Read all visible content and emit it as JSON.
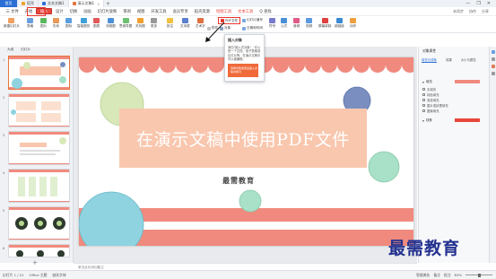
{
  "tabbar": {
    "home": "首页",
    "tabs": [
      {
        "label": "稻壳",
        "color": "#f0a030"
      },
      {
        "label": "文本文稿1",
        "color": "#2b6fd6"
      },
      {
        "label": "演示文稿1",
        "color": "#e8743a"
      }
    ],
    "add": "+",
    "window_controls": [
      "—",
      "❐",
      "✕"
    ]
  },
  "menu": {
    "items": [
      "三 文件",
      "开始",
      "插入",
      "设计",
      "切换",
      "动画",
      "幻灯片放映",
      "审阅",
      "视图",
      "开发工具",
      "会员专享",
      "稻壳资源",
      "绘图工具",
      "文本工具",
      "Q 查找"
    ],
    "selected": "插入",
    "right": [
      "未同步",
      "协作",
      "分享"
    ]
  },
  "ribbon": {
    "buttons": [
      "新建幻灯片",
      "表格",
      "图片",
      "形状",
      "图标",
      "智能图形",
      "图表",
      "流程图",
      "思维导图",
      "关系图",
      "更多",
      "批注",
      "文本框",
      "艺术字",
      "符号",
      "公式",
      "音频",
      "视频",
      "屏幕录制",
      "超链接",
      "动作"
    ],
    "small": [
      "PDF文件",
      "对象",
      "附件",
      "幻灯片编号",
      "日期和时间",
      "页眉页脚"
    ],
    "pdf_label": "PDF文件"
  },
  "tooltip": {
    "title": "插入对象",
    "body": "添加\"嵌入式对象\"，可以是一个文档、电子表格或幻灯片等，在演示文稿中可以被编辑。",
    "image_text": "选择对象类型后插入文稿中即可"
  },
  "left_pane": {
    "tabs": [
      "大纲",
      "幻灯片"
    ],
    "slide_numbers": [
      "1",
      "2",
      "3",
      "4",
      "5",
      "6"
    ],
    "thumb1_title": "在演示文稿中使用PDF文件",
    "add_icon": "+"
  },
  "slide": {
    "title": "在演示文稿中使用PDF文件",
    "subtitle": "最需教育",
    "colors": {
      "scallop": "#f08a7e",
      "title_box": "#f9c7ae",
      "circle_green": "#d8e8b8",
      "circle_blue": "#8fd3e0",
      "circle_navy": "#7a8fc0",
      "circle_mint": "#a8e0c8"
    }
  },
  "right_pane": {
    "header": "对象属性",
    "tabs": [
      "填充与线条",
      "效果",
      "大小与属性"
    ],
    "sections": [
      "填充",
      "线条"
    ],
    "checks": [
      "无填充",
      "纯色填充",
      "渐变填充",
      "图片或纹理填充",
      "图案填充"
    ]
  },
  "notes": "单击此处添加备注",
  "statusbar": {
    "left": [
      "幻灯片 1 / 21",
      "Office 主题",
      "缺失字体"
    ],
    "right": [
      "智能美化",
      "备注",
      "批注"
    ],
    "zoom": "83%"
  },
  "watermark": "最需教育"
}
